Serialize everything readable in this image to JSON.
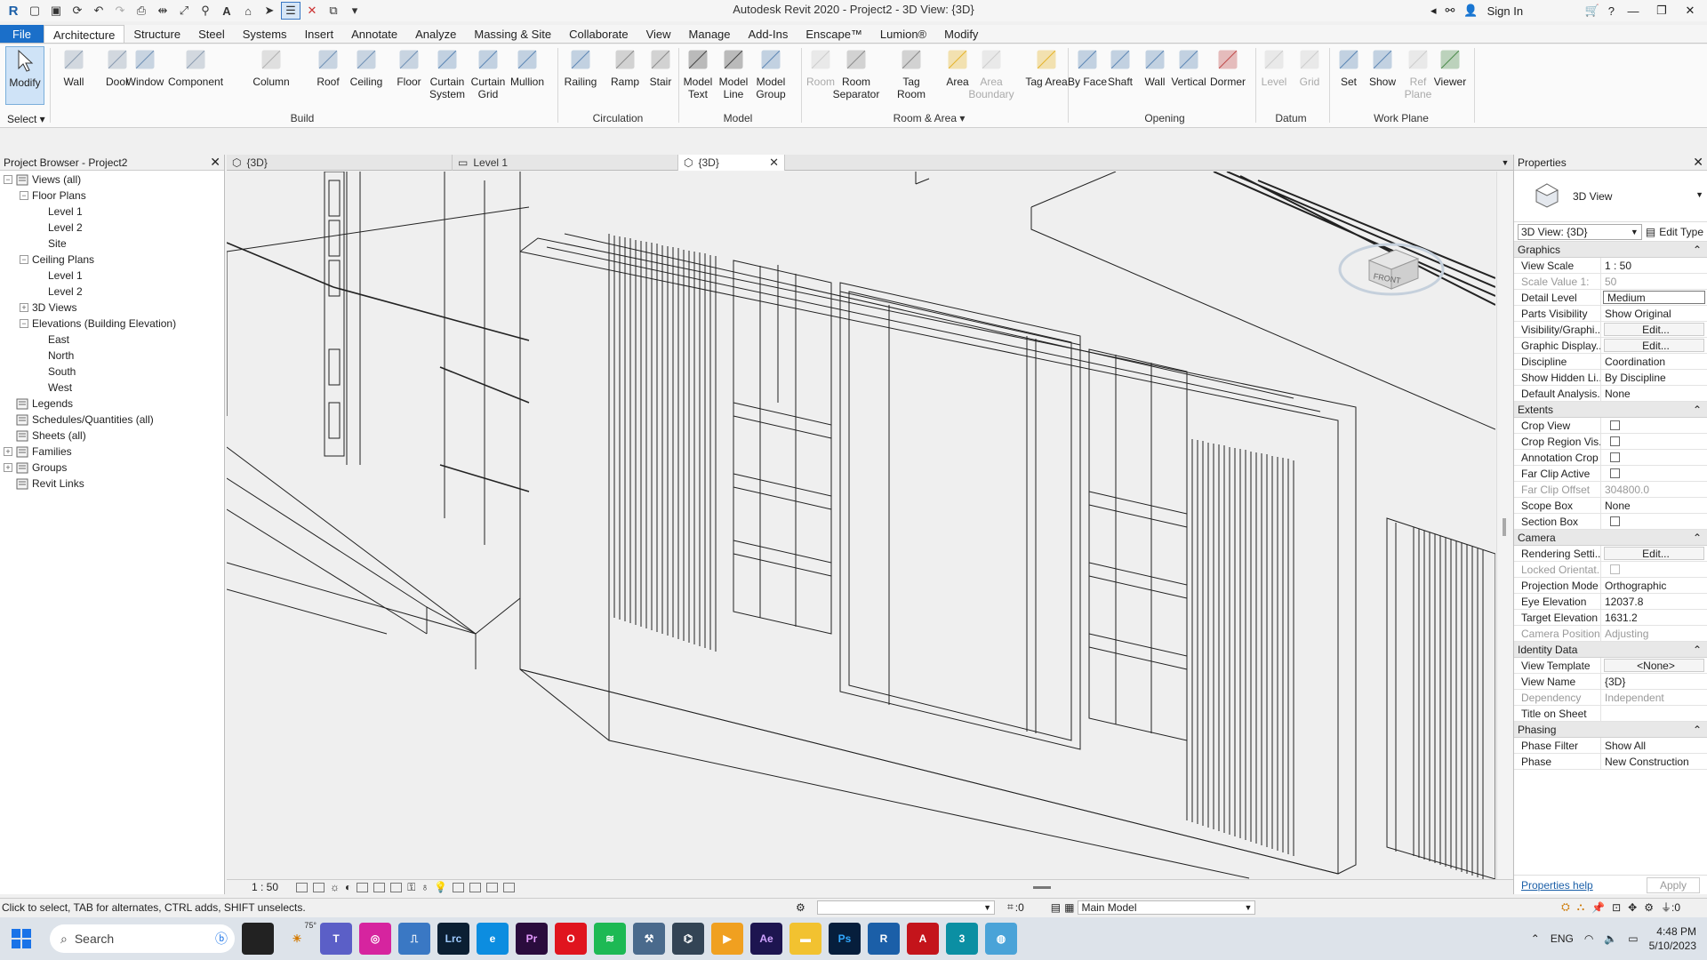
{
  "window": {
    "title": "Autodesk Revit 2020 - Project2 - 3D View: {3D}",
    "sign_in": "Sign In"
  },
  "ribbon_tabs": [
    "File",
    "Architecture",
    "Structure",
    "Steel",
    "Systems",
    "Insert",
    "Annotate",
    "Analyze",
    "Massing & Site",
    "Collaborate",
    "View",
    "Manage",
    "Add-Ins",
    "Enscape™",
    "Lumion®",
    "Modify"
  ],
  "ribbon": {
    "modify": "Modify",
    "select": "Select ▾",
    "build": {
      "label": "Build",
      "items": [
        "Wall",
        "Door",
        "Window",
        "Component",
        "Column",
        "Roof",
        "Ceiling",
        "Floor",
        "Curtain System",
        "Curtain Grid",
        "Mullion"
      ]
    },
    "circulation": {
      "label": "Circulation",
      "items": [
        "Railing",
        "Ramp",
        "Stair"
      ]
    },
    "model": {
      "label": "Model",
      "items": [
        "Model Text",
        "Model Line",
        "Model Group"
      ]
    },
    "room_area": {
      "label": "Room & Area ▾",
      "items": [
        "Room",
        "Room Separator",
        "Tag Room",
        "Area",
        "Area Boundary",
        "Tag Area"
      ]
    },
    "opening": {
      "label": "Opening",
      "items": [
        "By Face",
        "Shaft",
        "Wall",
        "Vertical",
        "Dormer"
      ]
    },
    "datum": {
      "label": "Datum",
      "items": [
        "Level",
        "Grid"
      ]
    },
    "work_plane": {
      "label": "Work Plane",
      "items": [
        "Set",
        "Show",
        "Ref Plane",
        "Viewer"
      ]
    }
  },
  "project_browser": {
    "title": "Project Browser - Project2",
    "tree": [
      {
        "label": "Views (all)",
        "level": 0,
        "toggle": "−"
      },
      {
        "label": "Floor Plans",
        "level": 1,
        "toggle": "−"
      },
      {
        "label": "Level 1",
        "level": 2
      },
      {
        "label": "Level 2",
        "level": 2
      },
      {
        "label": "Site",
        "level": 2
      },
      {
        "label": "Ceiling Plans",
        "level": 1,
        "toggle": "−"
      },
      {
        "label": "Level 1",
        "level": 2
      },
      {
        "label": "Level 2",
        "level": 2
      },
      {
        "label": "3D Views",
        "level": 1,
        "toggle": "+"
      },
      {
        "label": "Elevations (Building Elevation)",
        "level": 1,
        "toggle": "−"
      },
      {
        "label": "East",
        "level": 2
      },
      {
        "label": "North",
        "level": 2
      },
      {
        "label": "South",
        "level": 2
      },
      {
        "label": "West",
        "level": 2
      },
      {
        "label": "Legends",
        "level": 0
      },
      {
        "label": "Schedules/Quantities (all)",
        "level": 0
      },
      {
        "label": "Sheets (all)",
        "level": 0
      },
      {
        "label": "Families",
        "level": 0,
        "toggle": "+"
      },
      {
        "label": "Groups",
        "level": 0,
        "toggle": "+"
      },
      {
        "label": "Revit Links",
        "level": 0
      }
    ]
  },
  "view_tabs": [
    "{3D}",
    "Level 1",
    "{3D}"
  ],
  "view_control": {
    "scale": "1 : 50",
    "count": "0"
  },
  "properties": {
    "title": "Properties",
    "type_name": "3D View",
    "instance": "3D View: {3D}",
    "edit_type": "Edit Type",
    "groups": [
      {
        "name": "Graphics",
        "rows": [
          {
            "n": "View Scale",
            "v": "1 : 50"
          },
          {
            "n": "Scale Value    1:",
            "v": "50",
            "grey": true
          },
          {
            "n": "Detail Level",
            "v": "Medium",
            "boxed": true
          },
          {
            "n": "Parts Visibility",
            "v": "Show Original"
          },
          {
            "n": "Visibility/Graphi...",
            "v": "Edit...",
            "btn": true
          },
          {
            "n": "Graphic Display...",
            "v": "Edit...",
            "btn": true
          },
          {
            "n": "Discipline",
            "v": "Coordination"
          },
          {
            "n": "Show Hidden Li...",
            "v": "By Discipline"
          },
          {
            "n": "Default Analysis...",
            "v": "None"
          }
        ]
      },
      {
        "name": "Extents",
        "rows": [
          {
            "n": "Crop View",
            "cb": true
          },
          {
            "n": "Crop Region Vis...",
            "cb": true
          },
          {
            "n": "Annotation Crop",
            "cb": true
          },
          {
            "n": "Far Clip Active",
            "cb": true
          },
          {
            "n": "Far Clip Offset",
            "v": "304800.0",
            "grey": true
          },
          {
            "n": "Scope Box",
            "v": "None"
          },
          {
            "n": "Section Box",
            "cb": true
          }
        ]
      },
      {
        "name": "Camera",
        "rows": [
          {
            "n": "Rendering Setti...",
            "v": "Edit...",
            "btn": true
          },
          {
            "n": "Locked Orientat...",
            "cb": true,
            "grey": true
          },
          {
            "n": "Projection Mode",
            "v": "Orthographic"
          },
          {
            "n": "Eye Elevation",
            "v": "12037.8"
          },
          {
            "n": "Target Elevation",
            "v": "1631.2"
          },
          {
            "n": "Camera Position",
            "v": "Adjusting",
            "grey": true
          }
        ]
      },
      {
        "name": "Identity Data",
        "rows": [
          {
            "n": "View Template",
            "v": "<None>",
            "btn": true
          },
          {
            "n": "View Name",
            "v": "{3D}"
          },
          {
            "n": "Dependency",
            "v": "Independent",
            "grey": true
          },
          {
            "n": "Title on Sheet",
            "v": ""
          }
        ]
      },
      {
        "name": "Phasing",
        "rows": [
          {
            "n": "Phase Filter",
            "v": "Show All"
          },
          {
            "n": "Phase",
            "v": "New Construction"
          }
        ]
      }
    ],
    "help": "Properties help",
    "apply": "Apply"
  },
  "status": {
    "message": "Click to select, TAB for alternates, CTRL adds, SHIFT unselects.",
    "workset_count": ":0",
    "model": "Main Model",
    "filter_count": ":0"
  },
  "viewcube_label": "FRONT",
  "taskbar": {
    "search": "Search",
    "weather": "75°",
    "lang": "ENG",
    "time": "4:48 PM",
    "date": "5/10/2023"
  }
}
